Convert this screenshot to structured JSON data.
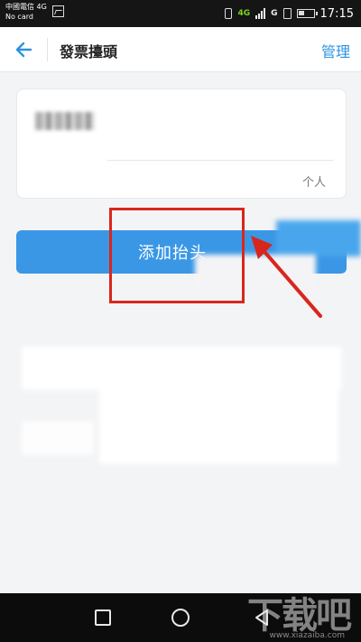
{
  "status_bar": {
    "carrier_line1": "中國電信 4G",
    "carrier_line2": "No card",
    "network_badge": "4G",
    "network_type": "G",
    "time": "17:15"
  },
  "header": {
    "title": "發票擡頭",
    "manage_label": "管理"
  },
  "invoice_card": {
    "type_label": "个人"
  },
  "add_button": {
    "label": "添加抬头"
  },
  "watermark": {
    "text": "下载吧",
    "url": "www.xiazaiba.com"
  },
  "colors": {
    "accent": "#3a97e6",
    "link": "#2a93e0",
    "highlight": "#d9261c"
  },
  "icons": {
    "back": "arrow-left-icon",
    "recent": "square-icon",
    "home": "circle-icon",
    "nav_back": "triangle-left-icon"
  }
}
